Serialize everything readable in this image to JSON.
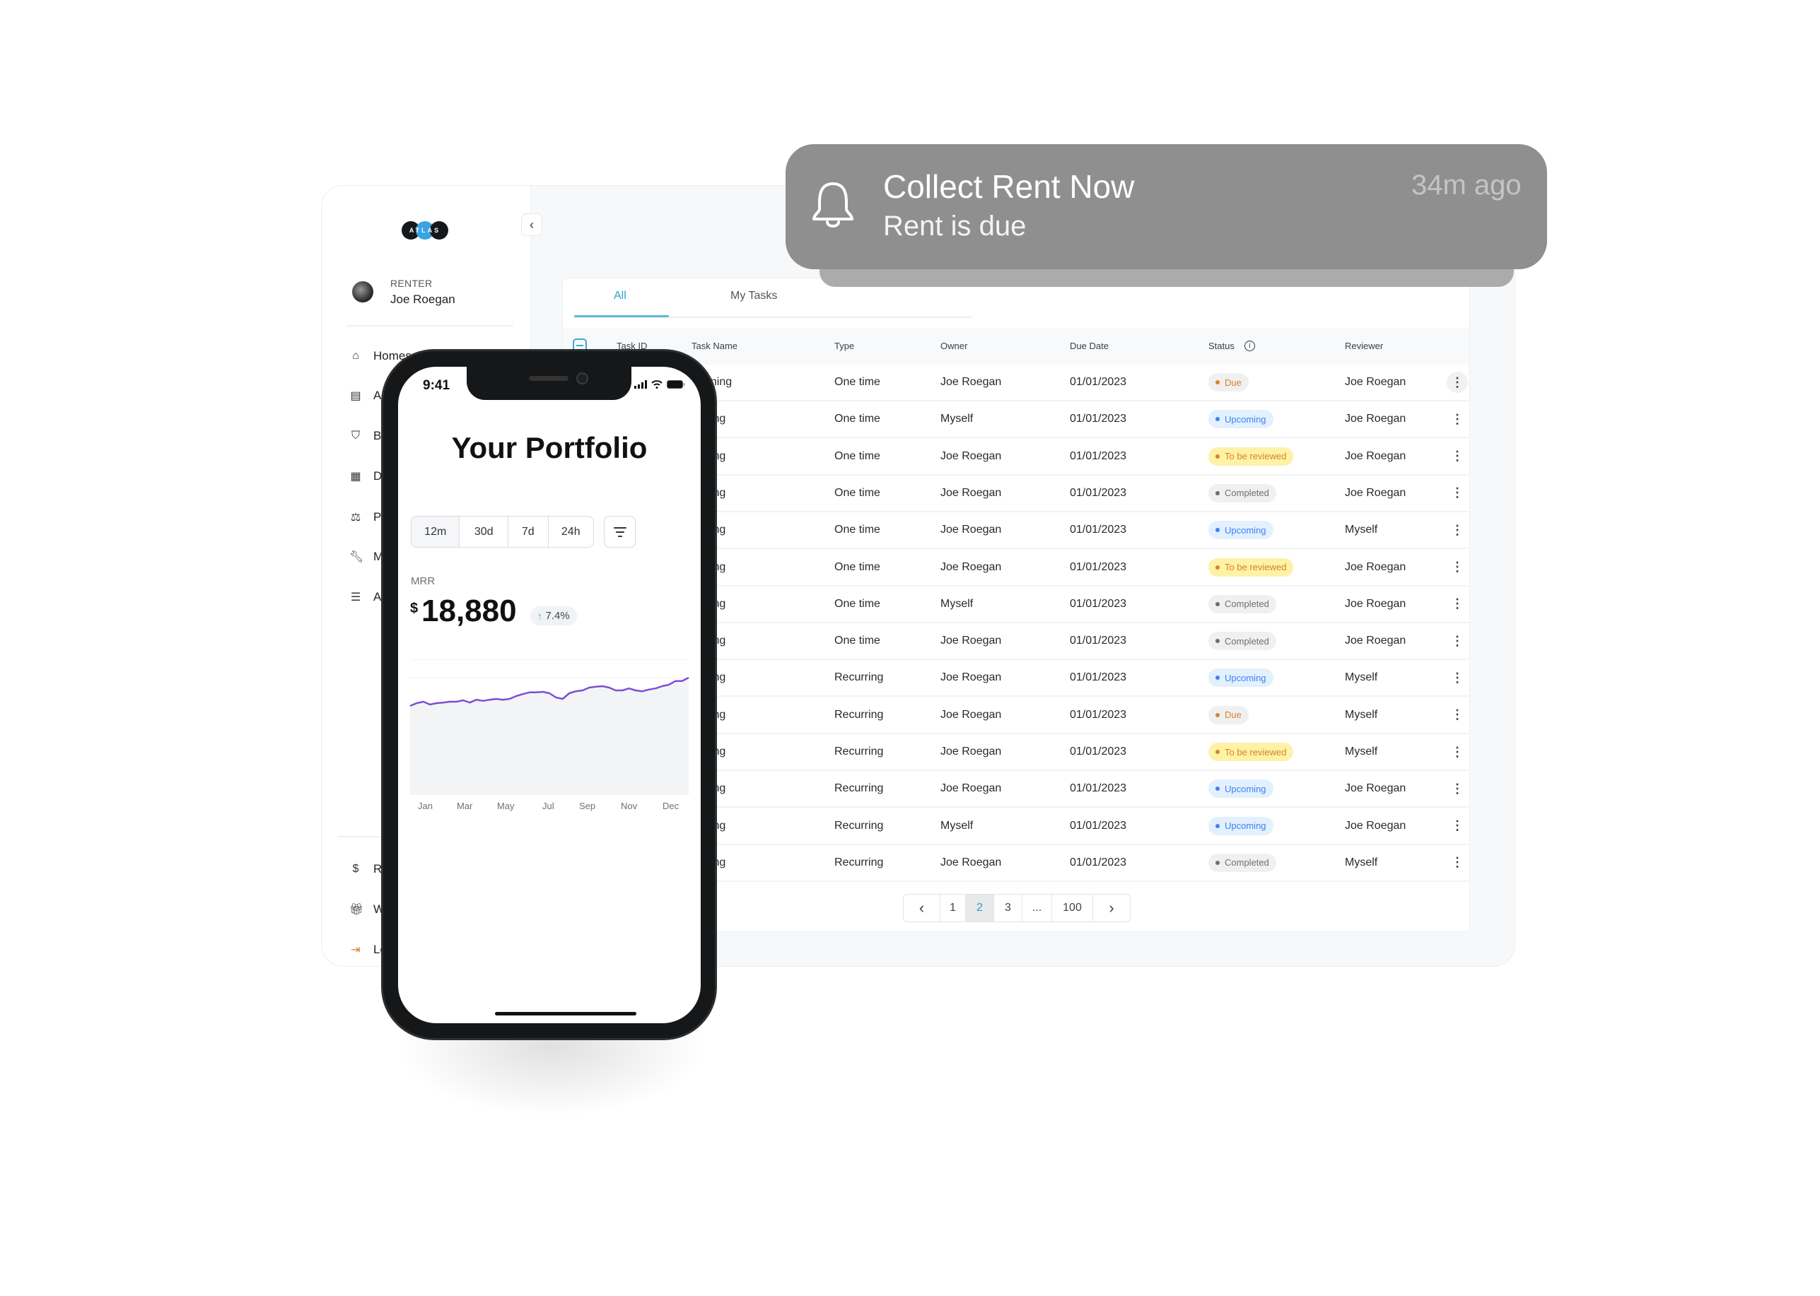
{
  "sidebar": {
    "logo_text": "ATLAS",
    "user_role": "RENTER",
    "user_name": "Joe Roegan",
    "collapse_icon": "chevron-left-icon",
    "nav_items": [
      {
        "label": "Homes",
        "icon": "storefront-icon"
      },
      {
        "label": "A",
        "icon": "clipboard-icon"
      },
      {
        "label": "B",
        "icon": "bookmark-icon"
      },
      {
        "label": "D",
        "icon": "document-icon"
      },
      {
        "label": "P",
        "icon": "scales-icon"
      },
      {
        "label": "M",
        "icon": "wrench-icon"
      },
      {
        "label": "A",
        "icon": "list-icon"
      }
    ],
    "bottom_items": [
      {
        "label": "Re",
        "icon": "dollar-icon"
      },
      {
        "label": "W",
        "icon": "gift-icon"
      },
      {
        "label": "Lo",
        "icon": "logout-icon"
      }
    ]
  },
  "tasks": {
    "tabs": [
      {
        "label": "All",
        "active": true
      },
      {
        "label": "My Tasks",
        "active": false
      }
    ],
    "columns": [
      "Task ID",
      "Task Name",
      "Type",
      "Owner",
      "Due Date",
      "Status",
      "Reviewer"
    ],
    "rows": [
      {
        "task_name": "aning",
        "type": "One time",
        "owner": "Joe Roegan",
        "due": "01/01/2023",
        "status": "Due",
        "reviewer": "Joe Roegan"
      },
      {
        "task_name": "ning",
        "type": "One time",
        "owner": "Myself",
        "due": "01/01/2023",
        "status": "Upcoming",
        "reviewer": "Joe Roegan"
      },
      {
        "task_name": "ning",
        "type": "One time",
        "owner": "Joe Roegan",
        "due": "01/01/2023",
        "status": "To be reviewed",
        "reviewer": "Joe Roegan"
      },
      {
        "task_name": "ning",
        "type": "One time",
        "owner": "Joe Roegan",
        "due": "01/01/2023",
        "status": "Completed",
        "reviewer": "Joe Roegan"
      },
      {
        "task_name": "ning",
        "type": "One time",
        "owner": "Joe Roegan",
        "due": "01/01/2023",
        "status": "Upcoming",
        "reviewer": "Myself"
      },
      {
        "task_name": "ning",
        "type": "One time",
        "owner": "Joe Roegan",
        "due": "01/01/2023",
        "status": "To be reviewed",
        "reviewer": "Joe Roegan"
      },
      {
        "task_name": "ning",
        "type": "One time",
        "owner": "Myself",
        "due": "01/01/2023",
        "status": "Completed",
        "reviewer": "Joe Roegan"
      },
      {
        "task_name": "ning",
        "type": "One time",
        "owner": "Joe Roegan",
        "due": "01/01/2023",
        "status": "Completed",
        "reviewer": "Joe Roegan"
      },
      {
        "task_name": "ning",
        "type": "Recurring",
        "owner": "Joe Roegan",
        "due": "01/01/2023",
        "status": "Upcoming",
        "reviewer": "Myself"
      },
      {
        "task_name": "ning",
        "type": "Recurring",
        "owner": "Joe Roegan",
        "due": "01/01/2023",
        "status": "Due",
        "reviewer": "Myself"
      },
      {
        "task_name": "ning",
        "type": "Recurring",
        "owner": "Joe Roegan",
        "due": "01/01/2023",
        "status": "To be reviewed",
        "reviewer": "Myself"
      },
      {
        "task_name": "ning",
        "type": "Recurring",
        "owner": "Joe Roegan",
        "due": "01/01/2023",
        "status": "Upcoming",
        "reviewer": "Joe Roegan"
      },
      {
        "task_name": "ning",
        "type": "Recurring",
        "owner": "Myself",
        "due": "01/01/2023",
        "status": "Upcoming",
        "reviewer": "Joe Roegan"
      },
      {
        "task_name": "ning",
        "type": "Recurring",
        "owner": "Joe Roegan",
        "due": "01/01/2023",
        "status": "Completed",
        "reviewer": "Myself"
      }
    ],
    "status_styles": {
      "Due": {
        "bg": "#f0f0f1",
        "fg": "#d9822b"
      },
      "Upcoming": {
        "bg": "#e3f0fd",
        "fg": "#3b82f6"
      },
      "To be reviewed": {
        "bg": "#fdf2a6",
        "fg": "#d9822b"
      },
      "Completed": {
        "bg": "#f0f0f1",
        "fg": "#6b7076"
      }
    },
    "pagination": {
      "prev": "‹",
      "pages": [
        "1",
        "2",
        "3",
        "...",
        "100"
      ],
      "current": "2",
      "next": "›"
    }
  },
  "notification": {
    "title": "Collect Rent Now",
    "body": "Rent is due",
    "time": "34m ago",
    "icon": "bell-icon"
  },
  "phone": {
    "time": "9:41",
    "title": "Your Portfolio",
    "ranges": [
      "12m",
      "30d",
      "7d",
      "24h"
    ],
    "active_range": "12m",
    "metric_label": "MRR",
    "currency": "$",
    "metric_value": "18,880",
    "change": "7.4%",
    "change_direction": "up",
    "accent": "#7b4fd6"
  },
  "chart_data": {
    "type": "area",
    "title": "",
    "xlabel": "",
    "ylabel": "MRR",
    "x_tick_labels": [
      "Jan",
      "Mar",
      "May",
      "Jul",
      "Sep",
      "Nov",
      "Dec"
    ],
    "grid": true,
    "ylim": [
      0,
      5
    ],
    "series": [
      {
        "name": "MRR",
        "color": "#7b4fd6",
        "values": [
          4.0,
          4.1,
          4.15,
          4.05,
          4.1,
          4.12,
          4.15,
          4.15,
          4.2,
          4.12,
          4.22,
          4.18,
          4.22,
          4.25,
          4.22,
          4.25,
          4.35,
          4.42,
          4.48,
          4.48,
          4.5,
          4.45,
          4.3,
          4.25,
          4.45,
          4.52,
          4.55,
          4.65,
          4.68,
          4.7,
          4.65,
          4.55,
          4.55,
          4.62,
          4.55,
          4.52,
          4.58,
          4.62,
          4.7,
          4.75,
          4.88,
          4.88,
          5.0
        ]
      }
    ]
  }
}
